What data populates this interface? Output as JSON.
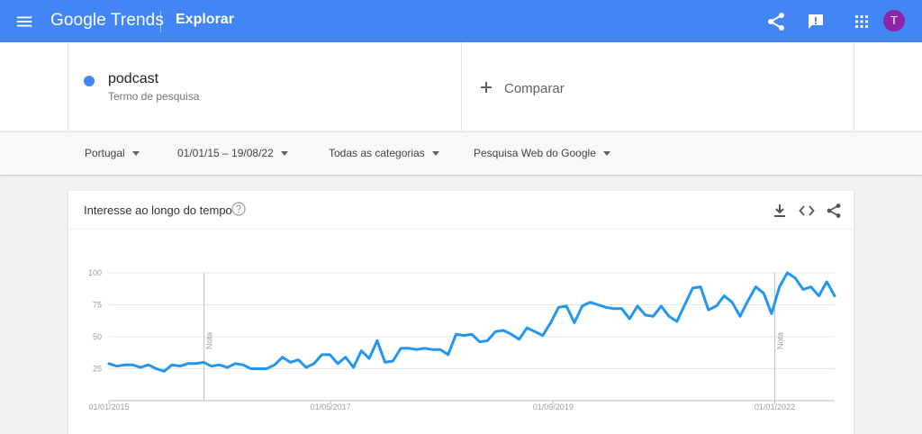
{
  "header": {
    "logo_text": "Google Trends",
    "page_title": "Explorar",
    "avatar_letter": "T",
    "brand_color": "#4285f4",
    "icons": [
      "menu-icon",
      "share-icon",
      "feedback-icon",
      "apps-icon"
    ]
  },
  "search_term": {
    "name": "podcast",
    "subtitle": "Termo de pesquisa",
    "color": "#4285f4"
  },
  "compare": {
    "label": "Comparar"
  },
  "filters": {
    "region": "Portugal",
    "date_range": "01/01/15 – 19/08/22",
    "category": "Todas as categorias",
    "search_type": "Pesquisa Web do Google"
  },
  "card": {
    "title": "Interesse ao longo do tempo",
    "icons": [
      "help-icon",
      "download-icon",
      "embed-icon",
      "share-icon"
    ]
  },
  "chart_data": {
    "type": "line",
    "title": "Interesse ao longo do tempo",
    "line_color": "#2196f3",
    "ylim": [
      0,
      100
    ],
    "y_ticks": [
      25,
      50,
      75,
      100
    ],
    "grid": true,
    "x_ticks": [
      {
        "label": "01/01/2015",
        "x": 2015.0
      },
      {
        "label": "01/05/2017",
        "x": 2017.33
      },
      {
        "label": "01/09/2019",
        "x": 2019.67
      },
      {
        "label": "01/01/2022",
        "x": 2022.0
      }
    ],
    "xlim": [
      2015.0,
      2022.63
    ],
    "notes": [
      {
        "label": "Nota",
        "x": 2016.0
      },
      {
        "label": "Nota",
        "x": 2022.0
      }
    ],
    "series": [
      {
        "values": [
          29,
          27,
          28,
          28,
          26,
          28,
          25,
          23,
          28,
          27,
          29,
          29,
          30,
          27,
          28,
          26,
          29,
          28,
          25,
          25,
          25,
          28,
          34,
          30,
          32,
          26,
          29,
          36,
          36,
          29,
          34,
          26,
          39,
          33,
          47,
          30,
          31,
          41,
          41,
          40,
          41,
          40,
          40,
          36,
          52,
          51,
          52,
          46,
          47,
          54,
          55,
          52,
          48,
          57,
          54,
          51,
          61,
          73,
          74,
          61,
          74,
          77,
          75,
          73,
          72,
          72,
          64,
          74,
          67,
          66,
          74,
          66,
          62,
          75,
          88,
          89,
          71,
          74,
          82,
          77,
          66,
          78,
          89,
          84,
          68,
          89,
          100,
          96,
          87,
          89,
          82,
          93,
          82
        ]
      }
    ]
  }
}
